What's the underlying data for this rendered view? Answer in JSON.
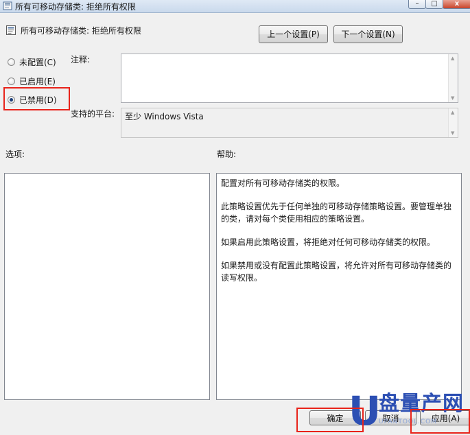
{
  "window": {
    "title": "所有可移动存储类: 拒绝所有权限",
    "minimize_glyph": "–",
    "maximize_glyph": "□",
    "close_glyph": "x"
  },
  "header": {
    "policy_name": "所有可移动存储类: 拒绝所有权限",
    "prev_button": "上一个设置(P)",
    "next_button": "下一个设置(N)"
  },
  "state": {
    "options": [
      {
        "label": "未配置(C)",
        "checked": false
      },
      {
        "label": "已启用(E)",
        "checked": false
      },
      {
        "label": "已禁用(D)",
        "checked": true
      }
    ]
  },
  "comment": {
    "label": "注释:",
    "value": ""
  },
  "platform": {
    "label": "支持的平台:",
    "value": "至少 Windows Vista"
  },
  "options_pane": {
    "label": "选项:"
  },
  "help_pane": {
    "label": "帮助:",
    "paragraphs": [
      "配置对所有可移动存储类的权限。",
      "此策略设置优先于任何单独的可移动存储策略设置。要管理单独的类，请对每个类使用相应的策略设置。",
      "如果启用此策略设置，将拒绝对任何可移动存储类的权限。",
      "如果禁用或没有配置此策略设置，将允许对所有可移动存储类的读写权限。"
    ]
  },
  "footer": {
    "ok_button": "确定",
    "cancel_button": "取消",
    "apply_button": "应用(A)"
  },
  "watermark": {
    "logo_letter": "U",
    "title": "盘量产网",
    "url": "UPANTOOL.COM"
  },
  "colors": {
    "annotation_highlight": "#e8231a",
    "watermark_blue": "#2c4fb3"
  },
  "icons": [
    "policy-icon",
    "title-icon"
  ]
}
